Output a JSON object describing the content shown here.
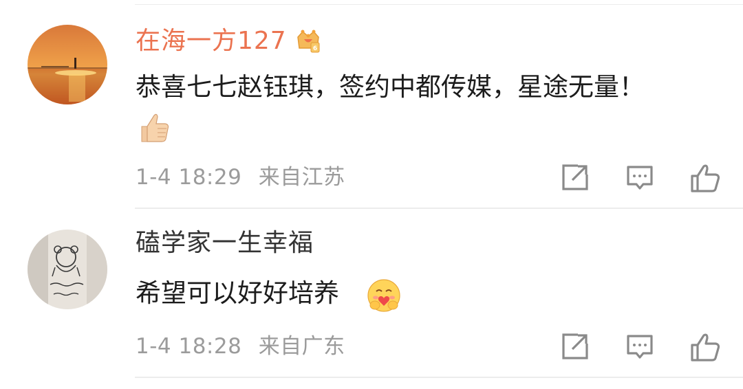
{
  "comments": [
    {
      "username": "在海一方127",
      "text": "恭喜七七赵钰琪，签约中都传媒，星途无量！",
      "time": "1-4 18:29",
      "location": "来自江苏",
      "has_vip_badge": true,
      "inline_emoji": "thumbs-up",
      "username_color": "#eb7350"
    },
    {
      "username": "磕学家一生幸福",
      "text": "希望可以好好培养",
      "time": "1-4 18:28",
      "location": "来自广东",
      "inline_emoji": "hugging-face",
      "username_color": "#333333"
    }
  ],
  "actions": {
    "share_icon": "share-icon",
    "reply_icon": "comment-icon",
    "like_icon": "thumbs-up-icon"
  }
}
